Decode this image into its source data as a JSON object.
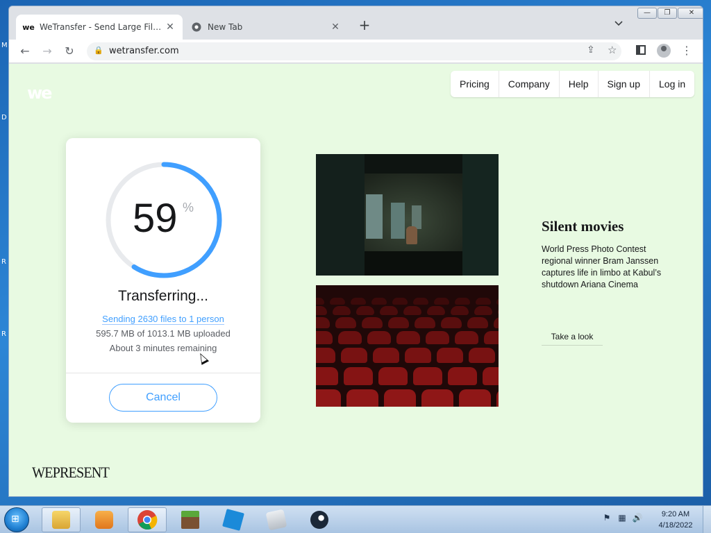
{
  "browser": {
    "tabs": [
      {
        "favicon": "we",
        "title": "WeTransfer - Send Large Files & Share Photos Online"
      },
      {
        "favicon": "chrome-icon",
        "title": "New Tab"
      }
    ],
    "url": "wetransfer.com"
  },
  "site": {
    "logo": "we",
    "nav": [
      "Pricing",
      "Company",
      "Help",
      "Sign up",
      "Log in"
    ]
  },
  "transfer": {
    "percent": 59,
    "percent_sign": "%",
    "status": "Transferring...",
    "sending": "Sending 2630 files to 1 person",
    "uploaded": "595.7 MB of 1013.1 MB uploaded",
    "remaining": "About 3 minutes remaining",
    "cancel_label": "Cancel",
    "progress_color": "#409fff"
  },
  "story": {
    "title": "Silent movies",
    "body": "World Press Photo Contest regional winner Bram Janssen captures life in limbo at Kabul’s shutdown Ariana Cinema",
    "cta": "Take a look"
  },
  "brand": "WEPRESENT",
  "taskbar": {
    "apps": [
      "explorer-icon",
      "media-player-icon",
      "chrome-icon",
      "minecraft-icon",
      "roblox-icon",
      "blank-app-icon",
      "steam-icon"
    ],
    "clock_time": "9:20 AM",
    "clock_date": "4/18/2022"
  }
}
